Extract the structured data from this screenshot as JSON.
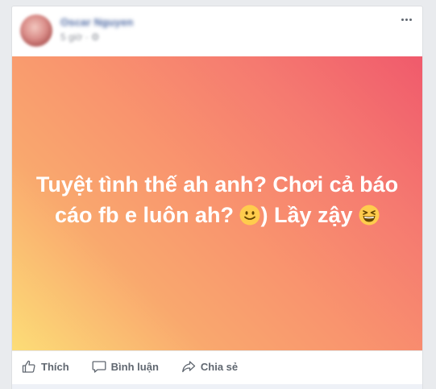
{
  "post": {
    "author_name": "Oscar Nguyen",
    "meta": "5 giờ · ⚙",
    "text": "Tuyệt tình thế ah anh? Chơi cả báo cáo fb e luôn ah?",
    "text_after_emoji": ") Lầy zậy",
    "emoji_1": "slightly-smiling-face",
    "emoji_2": "grinning-squinting-face",
    "background_gradient": [
      "#fcdd77",
      "#f9a86e",
      "#f57a70",
      "#f05a6c"
    ]
  },
  "actions": {
    "like": "Thích",
    "comment": "Bình luận",
    "share": "Chia sẻ"
  }
}
